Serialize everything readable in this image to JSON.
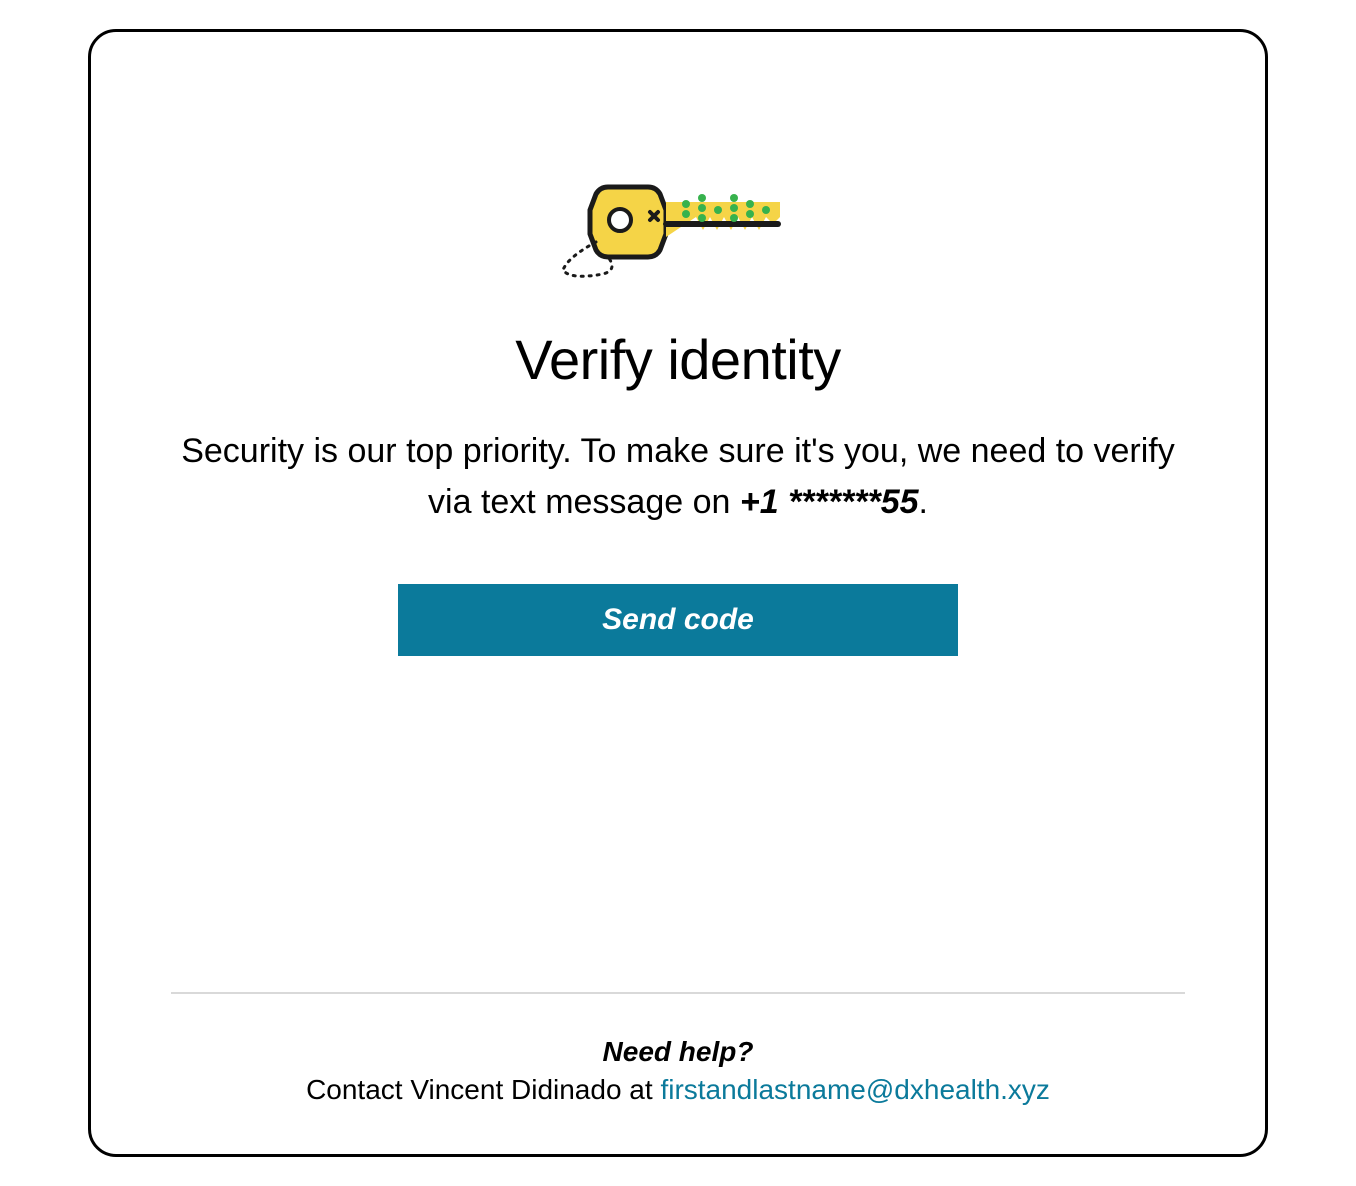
{
  "heading": "Verify identity",
  "description_prefix": "Security is our top priority. To make sure it's you, we need to verify via text message on ",
  "masked_phone": "+1 *******55",
  "description_suffix": ".",
  "send_code_label": "Send code",
  "footer": {
    "need_help": "Need help?",
    "contact_prefix": "Contact Vincent Didinado at ",
    "contact_email": "firstandlastname@dxhealth.xyz"
  },
  "colors": {
    "primary": "#0B7A9B",
    "text": "#000000",
    "divider": "#d9d9d9"
  }
}
